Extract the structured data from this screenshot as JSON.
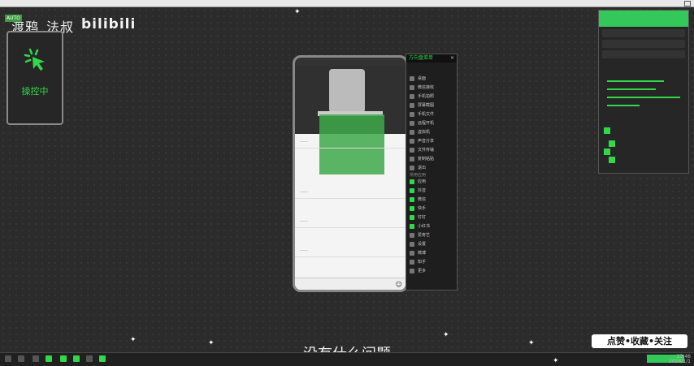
{
  "watermark": {
    "author": "渡鸦_法叔",
    "logo": "bilibili"
  },
  "control_panel": {
    "badge": "AUTO",
    "status": "操控中"
  },
  "phone": {
    "comments": [
      "……",
      "……",
      "……",
      "……"
    ],
    "emoji": "☺"
  },
  "side_menu": {
    "title": "方向盘菜单",
    "items": [
      "桌面",
      "微信接收",
      "手机拍照",
      "屏幕截图",
      "手机文件",
      "远程开机",
      "虚拟机",
      "声音分享",
      "文件传输",
      "复制粘贴",
      "退出"
    ],
    "section": "常用应用",
    "apps": [
      "应用",
      "抖音",
      "微信",
      "快手",
      "钉钉",
      "小红书",
      "爱奇艺",
      "设置",
      "微博",
      "知乎",
      "更多"
    ]
  },
  "subtitle": "没有什么问题",
  "banner": "点赞•收藏•关注",
  "taskbar": {
    "tray_time": "23:46",
    "tray_date": "2024/1/1"
  }
}
